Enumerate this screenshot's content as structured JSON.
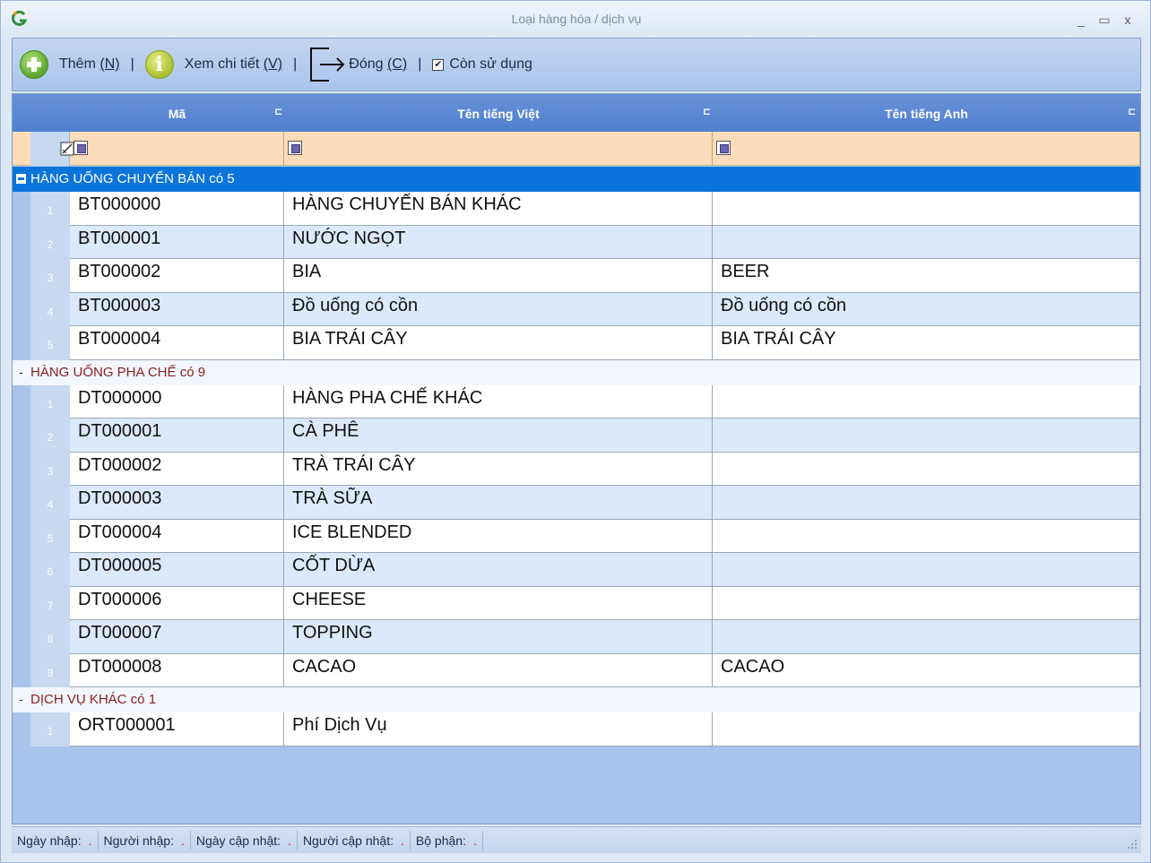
{
  "window": {
    "title": "Loại hàng hóa / dịch vụ",
    "minimize": "_",
    "maximize": "▭",
    "close": "x"
  },
  "toolbar": {
    "add_label": "Thêm",
    "add_shortcut": "(N)",
    "detail_label": "Xem chi tiết",
    "detail_shortcut": "(V)",
    "close_label": "Đóng",
    "close_shortcut": "(C)",
    "active_label": "Còn sử dụng",
    "active_checked": true,
    "separator": "|"
  },
  "grid": {
    "columns": [
      {
        "key": "ma",
        "label": "Mã"
      },
      {
        "key": "vi",
        "label": "Tên tiếng Việt"
      },
      {
        "key": "en",
        "label": "Tên tiếng Anh"
      }
    ],
    "groups": [
      {
        "label": "HÀNG UỐNG CHUYỂN BÁN có 5",
        "selected": true,
        "rows": [
          {
            "n": "1",
            "ma": "BT000000",
            "vi": "HÀNG CHUYỂN BÁN KHÁC",
            "en": ""
          },
          {
            "n": "2",
            "ma": "BT000001",
            "vi": "NƯỚC NGỌT",
            "en": ""
          },
          {
            "n": "3",
            "ma": "BT000002",
            "vi": "BIA",
            "en": "BEER"
          },
          {
            "n": "4",
            "ma": "BT000003",
            "vi": "Đồ uống có cồn",
            "en": "Đồ uống có cồn"
          },
          {
            "n": "5",
            "ma": "BT000004",
            "vi": "BIA TRÁI CÂY",
            "en": "BIA TRÁI CÂY"
          }
        ]
      },
      {
        "label": "HÀNG UỐNG PHA CHẾ có 9",
        "selected": false,
        "rows": [
          {
            "n": "1",
            "ma": "DT000000",
            "vi": "HÀNG PHA CHẾ KHÁC",
            "en": ""
          },
          {
            "n": "2",
            "ma": "DT000001",
            "vi": "CÀ PHÊ",
            "en": ""
          },
          {
            "n": "3",
            "ma": "DT000002",
            "vi": "TRÀ TRÁI CÂY",
            "en": ""
          },
          {
            "n": "4",
            "ma": "DT000003",
            "vi": "TRÀ SỮA",
            "en": ""
          },
          {
            "n": "5",
            "ma": "DT000004",
            "vi": "ICE BLENDED",
            "en": ""
          },
          {
            "n": "6",
            "ma": "DT000005",
            "vi": "CỐT DỪA",
            "en": ""
          },
          {
            "n": "7",
            "ma": "DT000006",
            "vi": "CHEESE",
            "en": ""
          },
          {
            "n": "8",
            "ma": "DT000007",
            "vi": "TOPPING",
            "en": ""
          },
          {
            "n": "9",
            "ma": "DT000008",
            "vi": "CACAO",
            "en": "CACAO"
          }
        ]
      },
      {
        "label": "DỊCH VỤ KHÁC có 1",
        "selected": false,
        "rows": [
          {
            "n": "1",
            "ma": "ORT000001",
            "vi": "Phí Dịch Vụ",
            "en": ""
          }
        ]
      }
    ]
  },
  "statusbar": {
    "items": [
      "Ngày nhập:",
      "Người nhập:",
      "Ngày cập nhật:",
      "Người cập nhật:",
      "Bộ phận:"
    ],
    "value_marker": "."
  },
  "colors": {
    "header_bg": "#5b88d4",
    "selected_group_bg": "#0b74db",
    "filter_row_bg": "#fddcb9",
    "group_text": "#8a1f1f"
  }
}
